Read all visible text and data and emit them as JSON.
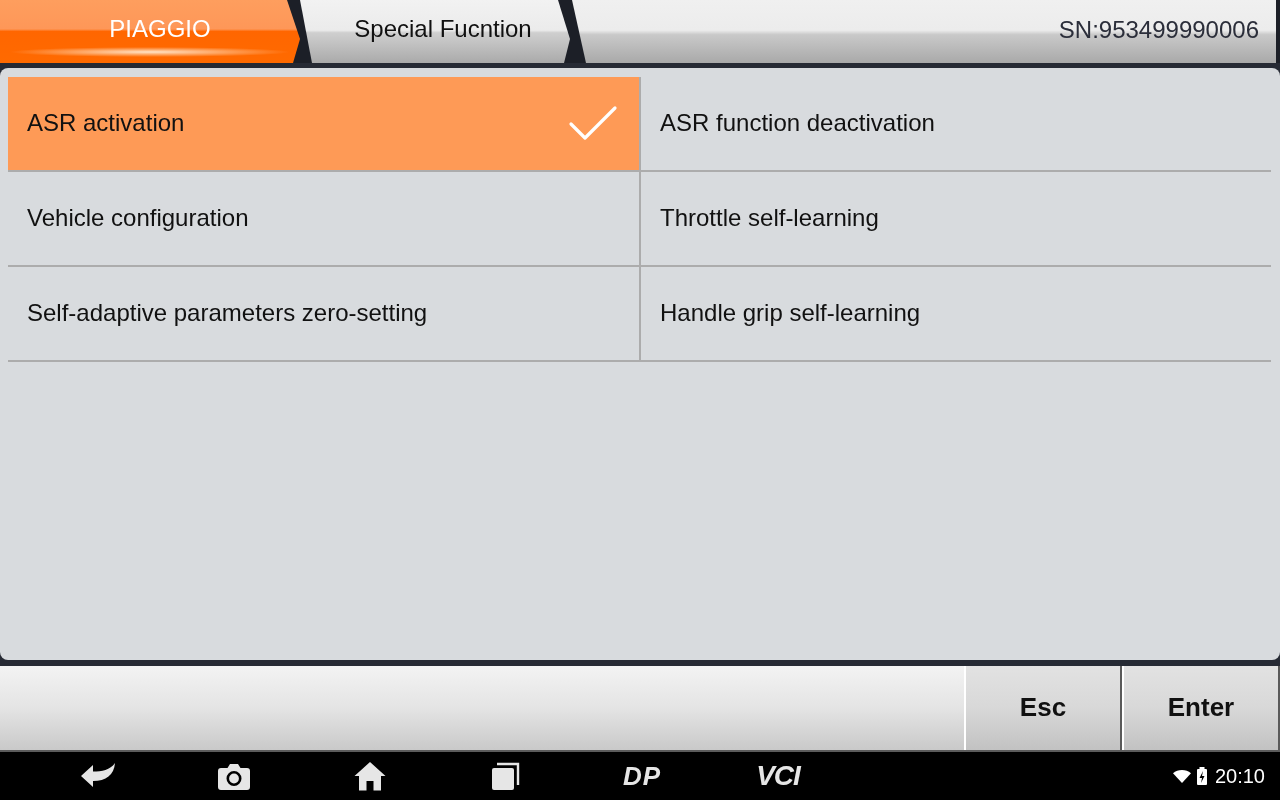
{
  "breadcrumb": [
    {
      "label": "PIAGGIO",
      "selected": true
    },
    {
      "label": "Special Fucntion",
      "selected": false
    }
  ],
  "serial_number": "SN:953499990006",
  "functions": [
    {
      "label": "ASR activation",
      "selected": true
    },
    {
      "label": "ASR function deactivation",
      "selected": false
    },
    {
      "label": "Vehicle configuration",
      "selected": false
    },
    {
      "label": "Throttle self-learning",
      "selected": false
    },
    {
      "label": "Self-adaptive parameters zero-setting",
      "selected": false
    },
    {
      "label": "Handle grip self-learning",
      "selected": false
    }
  ],
  "buttons": [
    "Esc",
    "Enter"
  ],
  "nav_bar": {
    "app_buttons": [
      "DP",
      "VCI"
    ],
    "time": "20:10"
  }
}
